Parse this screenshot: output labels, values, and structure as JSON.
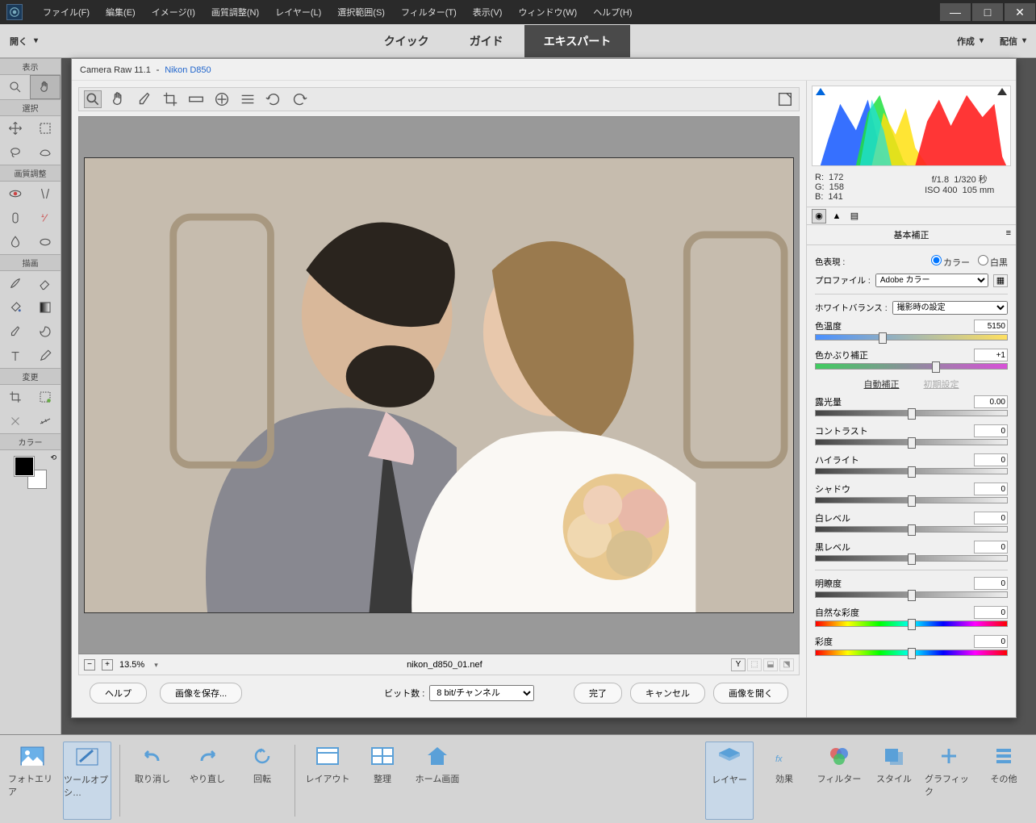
{
  "menubar": [
    "ファイル(F)",
    "編集(E)",
    "イメージ(I)",
    "画質調整(N)",
    "レイヤー(L)",
    "選択範囲(S)",
    "フィルター(T)",
    "表示(V)",
    "ウィンドウ(W)",
    "ヘルプ(H)"
  ],
  "optionbar": {
    "open": "開く",
    "tabs": [
      "クイック",
      "ガイド",
      "エキスパート"
    ],
    "active_tab": 2,
    "create": "作成",
    "distribute": "配信"
  },
  "toolbox": {
    "groups": [
      "表示",
      "選択",
      "画質調整",
      "描画",
      "変更",
      "カラー"
    ]
  },
  "raw": {
    "title_app": "Camera Raw 11.1",
    "title_cam": "Nikon D850",
    "zoom": "13.5%",
    "filename": "nikon_d850_01.nef",
    "help": "ヘルプ",
    "save_image": "画像を保存...",
    "bitdepth_label": "ビット数 :",
    "bitdepth_value": "8 bit/チャンネル",
    "done": "完了",
    "cancel": "キャンセル",
    "open_image": "画像を開く",
    "rgb": {
      "r_label": "R:",
      "r": "172",
      "g_label": "G:",
      "g": "158",
      "b_label": "B:",
      "b": "141"
    },
    "exif": {
      "aperture": "f/1.8",
      "shutter": "1/320 秒",
      "iso": "ISO 400",
      "focal": "105 mm"
    }
  },
  "panel": {
    "title": "基本補正",
    "treatment_label": "色表現 :",
    "treatment_color": "カラー",
    "treatment_bw": "白黒",
    "profile_label": "プロファイル :",
    "profile_value": "Adobe カラー",
    "wb_label": "ホワイトバランス :",
    "wb_value": "撮影時の設定",
    "temp_label": "色温度",
    "temp_value": "5150",
    "tint_label": "色かぶり補正",
    "tint_value": "+1",
    "auto": "自動補正",
    "default": "初期設定",
    "exposure_label": "露光量",
    "exposure_value": "0.00",
    "contrast_label": "コントラスト",
    "contrast_value": "0",
    "highlights_label": "ハイライト",
    "highlights_value": "0",
    "shadows_label": "シャドウ",
    "shadows_value": "0",
    "whites_label": "白レベル",
    "whites_value": "0",
    "blacks_label": "黒レベル",
    "blacks_value": "0",
    "clarity_label": "明瞭度",
    "clarity_value": "0",
    "vibrance_label": "自然な彩度",
    "vibrance_value": "0",
    "saturation_label": "彩度",
    "saturation_value": "0"
  },
  "bottombar": {
    "left": [
      "フォトエリア",
      "ツールオプシ…",
      "取り消し",
      "やり直し",
      "回転",
      "レイアウト",
      "整理",
      "ホーム画面"
    ],
    "right": [
      "レイヤー",
      "効果",
      "フィルター",
      "スタイル",
      "グラフィック",
      "その他"
    ]
  }
}
